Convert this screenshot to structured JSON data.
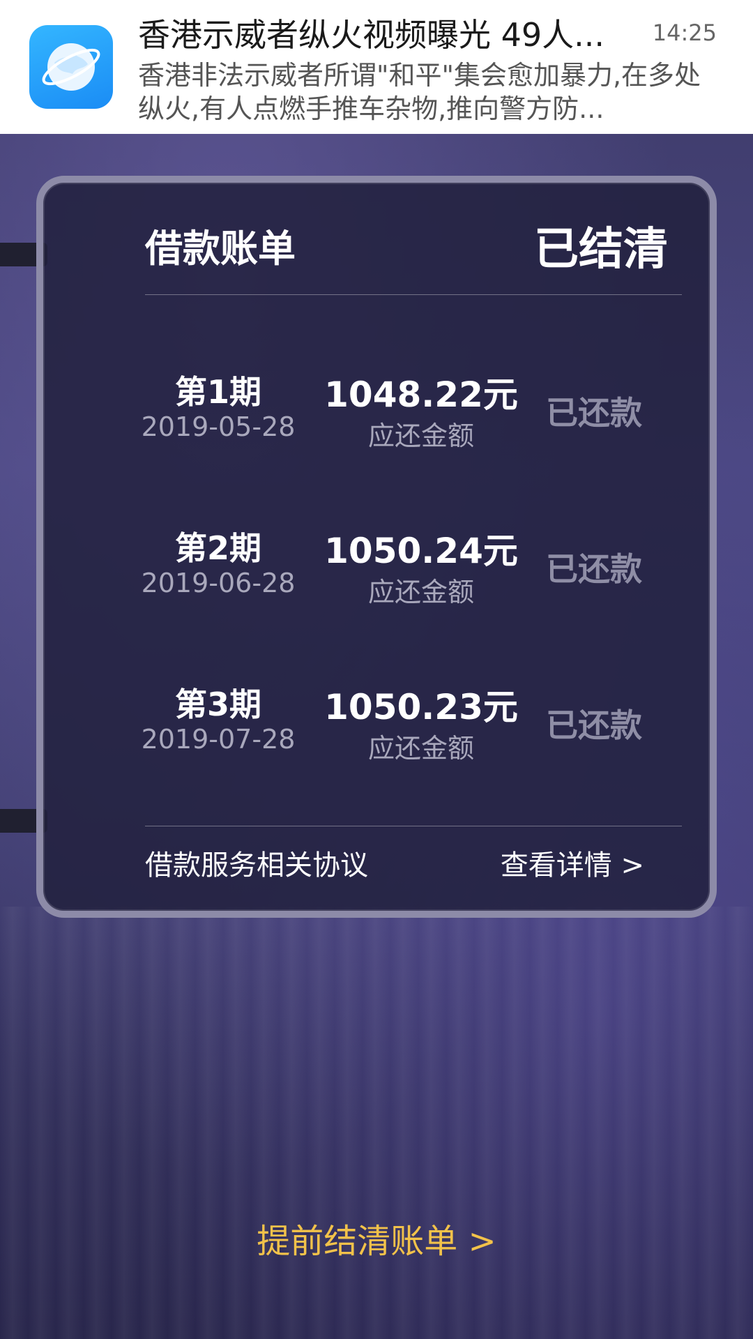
{
  "notification": {
    "app_icon": "globe-icon",
    "title": "香港示威者纵火视频曝光 49人...",
    "time": "14:25",
    "body": "香港非法示威者所谓\"和平\"集会愈加暴力,在多处纵火,有人点燃手推车杂物,推向警方防..."
  },
  "card": {
    "title": "借款账单",
    "status": "已结清",
    "installments": [
      {
        "period": "第1期",
        "date": "2019-05-28",
        "amount": "1048.22元",
        "amount_label": "应还金额",
        "status": "已还款"
      },
      {
        "period": "第2期",
        "date": "2019-06-28",
        "amount": "1050.24元",
        "amount_label": "应还金额",
        "status": "已还款"
      },
      {
        "period": "第3期",
        "date": "2019-07-28",
        "amount": "1050.23元",
        "amount_label": "应还金额",
        "status": "已还款"
      }
    ],
    "agreement_label": "借款服务相关协议",
    "details_link": "查看详情 >"
  },
  "settle_early_link": "提前结清账单 >",
  "colors": {
    "accent_yellow": "#f2c24a",
    "card_border": "#8d8ba8",
    "muted_text": "#a9a8bc"
  }
}
